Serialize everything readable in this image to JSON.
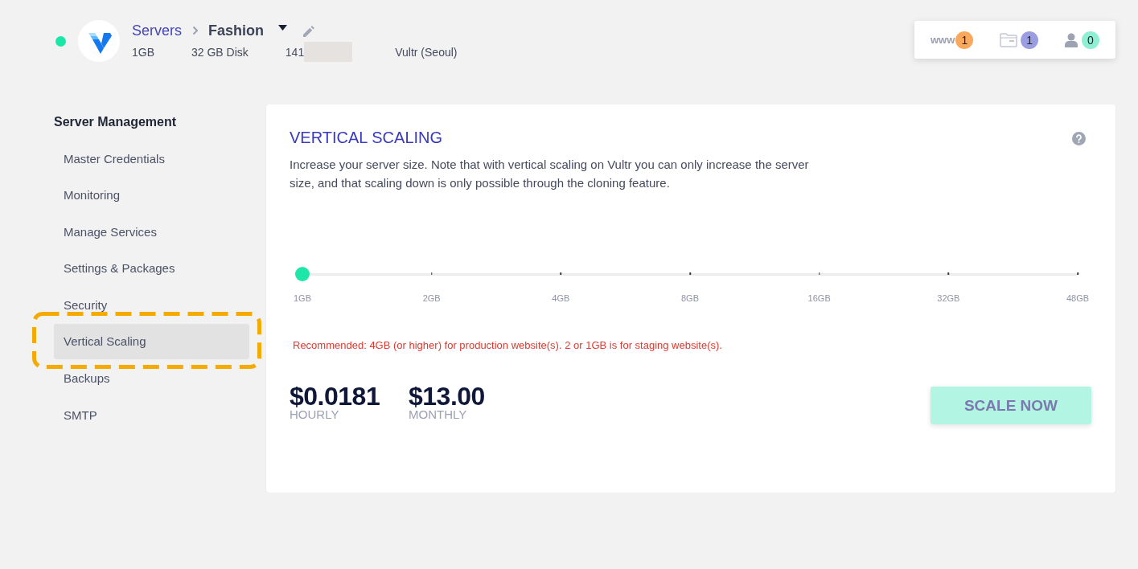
{
  "header": {
    "online": true,
    "breadcrumb": {
      "parent": "Servers",
      "current": "Fashion"
    },
    "specs": [
      {
        "kind": "text",
        "text": "1GB"
      },
      {
        "kind": "text",
        "text": "32 GB Disk"
      },
      {
        "kind": "masked",
        "text": "141"
      },
      {
        "kind": "text",
        "text": "Vultr (Seoul)"
      }
    ]
  },
  "counters": [
    {
      "kind": "www",
      "label": "www",
      "count": "1",
      "color": "#f9a85c"
    },
    {
      "kind": "folder",
      "count": "1",
      "color": "#9a9ee0"
    },
    {
      "kind": "user",
      "count": "0",
      "color": "#8eefd2"
    }
  ],
  "sidebar": {
    "title": "Server Management",
    "items": [
      {
        "label": "Master Credentials",
        "selected": false,
        "highlighted": false
      },
      {
        "label": "Monitoring",
        "selected": false,
        "highlighted": false
      },
      {
        "label": "Manage Services",
        "selected": false,
        "highlighted": false
      },
      {
        "label": "Settings & Packages",
        "selected": false,
        "highlighted": false
      },
      {
        "label": "Security",
        "selected": false,
        "highlighted": false
      },
      {
        "label": "Vertical Scaling",
        "selected": true,
        "highlighted": true
      },
      {
        "label": "Backups",
        "selected": false,
        "highlighted": false
      },
      {
        "label": "SMTP",
        "selected": false,
        "highlighted": false
      }
    ]
  },
  "panel": {
    "title": "VERTICAL SCALING",
    "description": "Increase your server size. Note that with vertical scaling on Vultr you can only increase the server size, and that scaling down is only possible through the cloning feature.",
    "slider": {
      "level": 0,
      "ticks": [
        "1GB",
        "2GB",
        "4GB",
        "8GB",
        "16GB",
        "32GB",
        "48GB"
      ]
    },
    "recommendation": "Recommended: 4GB (or higher) for production website(s). 2 or 1GB is for staging website(s).",
    "prices": [
      {
        "amount": "$0.0181",
        "period": "HOURLY"
      },
      {
        "amount": "$13.00",
        "period": "MONTHLY"
      }
    ],
    "button": {
      "label": "SCALE NOW",
      "disabled": true
    }
  }
}
